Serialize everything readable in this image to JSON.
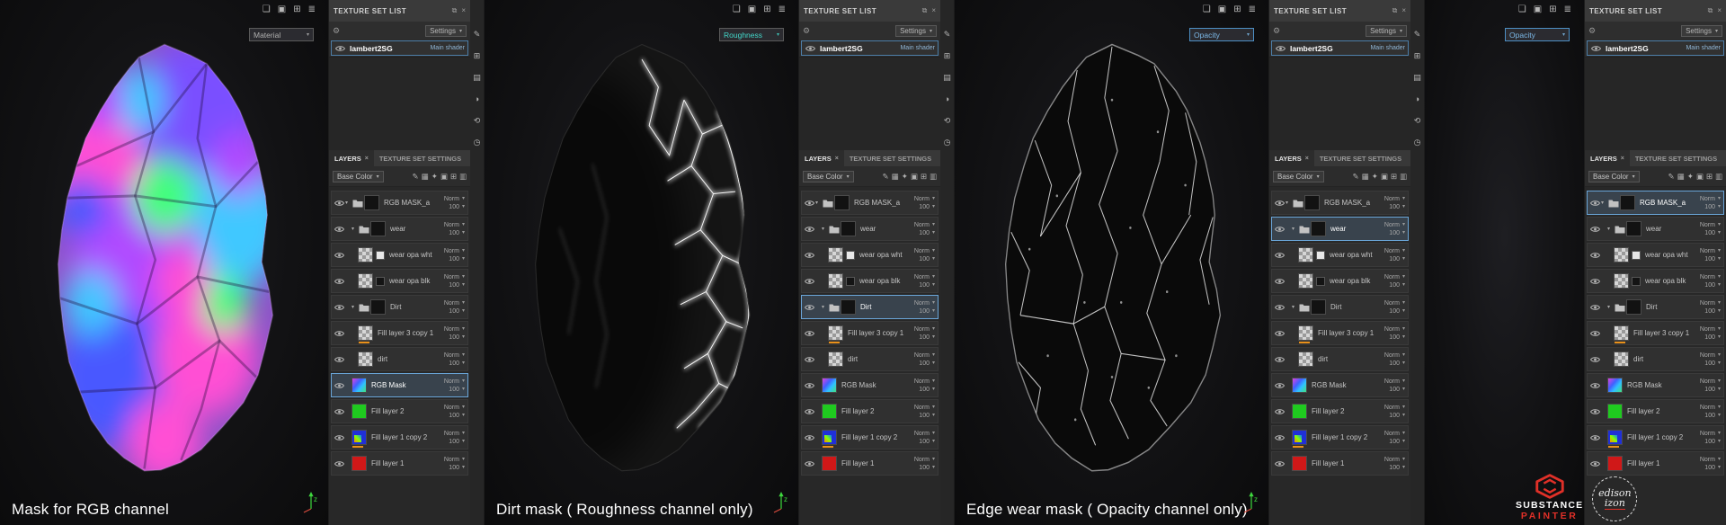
{
  "accent": {
    "selection_blue": "#6aa5d8",
    "active_channel_orange": "#e8901a",
    "axis_green": "#3ed83e",
    "axis_red": "#d84a3e",
    "brand_red": "#e03028"
  },
  "icons": {
    "caret_down": "▾",
    "close": "×",
    "gear": "⚙"
  },
  "viewport_toolbar_icons": [
    {
      "name": "panels-icon",
      "glyph": "❏"
    },
    {
      "name": "camera-icon",
      "glyph": "▣"
    },
    {
      "name": "display-settings-icon",
      "glyph": "⊞"
    },
    {
      "name": "menu-icon",
      "glyph": "≣"
    }
  ],
  "left_toolbar_icons": [
    {
      "name": "paint-tool-icon",
      "glyph": "✎"
    },
    {
      "name": "eraser-tool-icon",
      "glyph": "⊞"
    },
    {
      "name": "projection-tool-icon",
      "glyph": "▤"
    },
    {
      "name": "polygon-fill-tool-icon",
      "glyph": "◑"
    },
    {
      "name": "smudge-tool-icon",
      "glyph": "⟲"
    },
    {
      "name": "history-icon",
      "glyph": "◷"
    }
  ],
  "panel": {
    "texture_set_list": {
      "title": "TEXTURE SET LIST",
      "settings_label": "Settings",
      "shader_name": "lambert2SG",
      "shader_type": "Main shader"
    },
    "header_icons": [
      {
        "name": "pop-out-icon",
        "glyph": "⧉"
      },
      {
        "name": "close-icon",
        "glyph": "×"
      }
    ],
    "tabs": [
      {
        "label": "LAYERS"
      },
      {
        "label": "TEXTURE SET SETTINGS"
      }
    ],
    "channel_selector": "Base Color",
    "layer_toolbar_icons": [
      {
        "name": "pencil-icon",
        "glyph": "✎"
      },
      {
        "name": "stamp-icon",
        "glyph": "▦"
      },
      {
        "name": "effects-icon",
        "glyph": "✦"
      },
      {
        "name": "add-mask-icon",
        "glyph": "▣"
      },
      {
        "name": "add-folder-icon",
        "glyph": "⊞"
      },
      {
        "name": "trash-icon",
        "glyph": "▥"
      }
    ],
    "blend_label": "Norm",
    "opacity_value": "100"
  },
  "layers": [
    {
      "name": "RGB MASK_a",
      "type": "folder",
      "indent": 0,
      "thumb": "dark"
    },
    {
      "name": "wear",
      "type": "folder",
      "indent": 1,
      "thumb": "dark"
    },
    {
      "name": "wear opa wht",
      "type": "layer",
      "indent": 2,
      "thumb": "checker-white"
    },
    {
      "name": "wear opa blk",
      "type": "layer",
      "indent": 2,
      "thumb": "checker-black"
    },
    {
      "name": "Dirt",
      "type": "folder",
      "indent": 1,
      "thumb": "dark"
    },
    {
      "name": "Fill layer 3 copy 1",
      "type": "layer",
      "indent": 2,
      "thumb": "checker",
      "marker": true
    },
    {
      "name": "dirt",
      "type": "layer",
      "indent": 2,
      "thumb": "checker"
    },
    {
      "name": "RGB Mask",
      "type": "layer",
      "indent": 1,
      "thumb": "rgb"
    },
    {
      "name": "Fill layer 2",
      "type": "layer",
      "indent": 1,
      "thumb": "green"
    },
    {
      "name": "Fill layer 1 copy 2",
      "type": "layer",
      "indent": 1,
      "thumb": "blue",
      "marker": true
    },
    {
      "name": "Fill layer 1",
      "type": "layer",
      "indent": 1,
      "thumb": "red"
    }
  ],
  "sections": [
    {
      "caption": "Mask for RGB channel",
      "channel": {
        "label": "Material",
        "text_color": "#b0b0b0",
        "border_color": "#5a5a5a"
      },
      "selected_layer": "RGB Mask",
      "rock_style": "rgb"
    },
    {
      "caption": "Dirt mask ( Roughness channel only)",
      "channel": {
        "label": "Roughness",
        "text_color": "#43d6c9",
        "border_color": "#5a5a5a"
      },
      "selected_layer": "Dirt",
      "rock_style": "dirt"
    },
    {
      "caption": "Edge wear mask ( Opacity channel only)",
      "channel": {
        "label": "Opacity",
        "text_color": "#7cb9e8",
        "border_color": "#4d8fc4"
      },
      "selected_layer": "wear",
      "rock_style": "wear"
    },
    {
      "caption": "",
      "channel": {
        "label": "Opacity",
        "text_color": "#7cb9e8",
        "border_color": "#4d8fc4"
      },
      "selected_layer": "RGB MASK_a",
      "rock_style": "none"
    }
  ],
  "axis_gizmo": {
    "label": "z"
  },
  "rock_colors": {
    "rgb_base": "#8c52c8",
    "rgb_blobs": [
      "#ff4fd4",
      "#7a50ff",
      "#3fc8ff",
      "#b048ff",
      "#4858ff",
      "#3fff7a"
    ],
    "facet_line": "#1d0836",
    "mask_crack": "#ffffff",
    "rock_dark": "#151515"
  },
  "watermark": {
    "brand_line1": "SUBSTANCE",
    "brand_line2": "PAINTER",
    "author_line1": "edison",
    "author_line2": "izon"
  }
}
